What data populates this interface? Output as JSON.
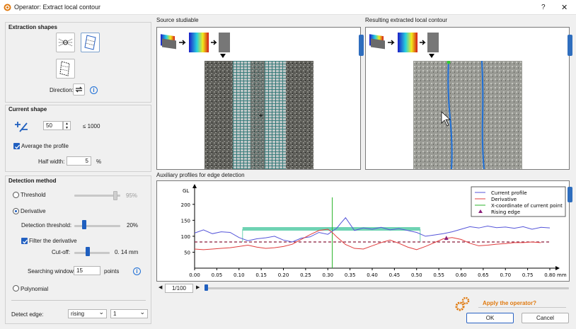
{
  "window": {
    "title": "Operator: Extract local contour",
    "help": "?",
    "close": "✕"
  },
  "extraction": {
    "heading": "Extraction shapes",
    "direction_label": "Direction:"
  },
  "current_shape": {
    "heading": "Current shape",
    "size_value": "50",
    "size_max": "≤ 1000",
    "average_label": "Average the profile",
    "half_width_label": "Half width:",
    "half_width_value": "5",
    "half_width_unit": "%"
  },
  "detection": {
    "heading": "Detection method",
    "threshold_label": "Threshold",
    "threshold_value": "95%",
    "derivative_label": "Derivative",
    "detection_threshold_label": "Detection threshold:",
    "detection_threshold_value": "20%",
    "filter_label": "Filter the derivative",
    "cutoff_label": "Cut-off:",
    "cutoff_value": "0. 14 mm",
    "searching_label": "Searching window:",
    "searching_value": "15",
    "searching_unit": "points",
    "polynomial_label": "Polynomial",
    "detect_edge_label": "Detect edge:",
    "detect_edge_value": "rising",
    "detect_edge_count": "1"
  },
  "panels": {
    "source_label": "Source studiable",
    "result_label": "Resulting extracted local contour",
    "aux_label": "Auxiliary profiles for edge detection"
  },
  "pager": {
    "value": "1/100"
  },
  "footer": {
    "apply_text": "Apply the operator?",
    "ok_label": "OK",
    "cancel_label": "Cancel"
  },
  "colors": {
    "accent": "#1f5fbf",
    "current_profile": "#5555d9",
    "derivative": "#e03c3c",
    "xcoord": "#2db52d",
    "rising": "#8b1f7a",
    "threshold_line": "#8b1b3b",
    "band": "#6fd3b3",
    "orange": "#e07a10"
  },
  "chart_data": {
    "type": "line",
    "ylabel": "GL",
    "xunit": "mm",
    "xlim": [
      0,
      0.8
    ],
    "ylim": [
      0,
      255
    ],
    "x_ticks": [
      "0.00",
      "0.05",
      "0.10",
      "0.15",
      "0.20",
      "0.25",
      "0.30",
      "0.35",
      "0.40",
      "0.45",
      "0.50",
      "0.55",
      "0.60",
      "0.65",
      "0.70",
      "0.75",
      "0.80"
    ],
    "y_ticks": [
      "50",
      "100",
      "150",
      "200"
    ],
    "legend": [
      "Current profile",
      "Derivative",
      "X-coordinate of current point",
      "Rising edge"
    ],
    "legend_placement": "top-right",
    "series": [
      {
        "name": "Current profile",
        "x": [
          0.0,
          0.02,
          0.04,
          0.06,
          0.08,
          0.1,
          0.12,
          0.14,
          0.16,
          0.18,
          0.2,
          0.22,
          0.24,
          0.26,
          0.28,
          0.3,
          0.32,
          0.33,
          0.34,
          0.36,
          0.38,
          0.4,
          0.42,
          0.44,
          0.46,
          0.48,
          0.5,
          0.52,
          0.54,
          0.56,
          0.58,
          0.6,
          0.62,
          0.64,
          0.66,
          0.68,
          0.7,
          0.72,
          0.74,
          0.76,
          0.78,
          0.8
        ],
        "y": [
          110,
          120,
          108,
          114,
          112,
          96,
          86,
          92,
          95,
          100,
          88,
          82,
          94,
          98,
          112,
          106,
          125,
          142,
          158,
          118,
          126,
          122,
          128,
          120,
          124,
          118,
          112,
          100,
          104,
          108,
          114,
          122,
          130,
          126,
          132,
          127,
          129,
          125,
          130,
          122,
          128,
          126
        ]
      },
      {
        "name": "Derivative",
        "x": [
          0.0,
          0.02,
          0.04,
          0.06,
          0.08,
          0.1,
          0.12,
          0.14,
          0.16,
          0.18,
          0.2,
          0.22,
          0.24,
          0.26,
          0.28,
          0.3,
          0.31,
          0.32,
          0.34,
          0.36,
          0.38,
          0.4,
          0.42,
          0.44,
          0.46,
          0.48,
          0.5,
          0.52,
          0.54,
          0.56,
          0.58,
          0.6,
          0.62,
          0.64,
          0.66,
          0.68,
          0.7,
          0.72,
          0.74,
          0.76,
          0.78
        ],
        "y": [
          60,
          58,
          60,
          62,
          64,
          68,
          72,
          66,
          62,
          64,
          68,
          75,
          90,
          105,
          118,
          122,
          112,
          98,
          74,
          62,
          60,
          70,
          80,
          88,
          78,
          66,
          58,
          68,
          80,
          92,
          96,
          90,
          78,
          70,
          72,
          75,
          77,
          80,
          80,
          82,
          80
        ]
      },
      {
        "name": "Threshold",
        "y_const": 82
      }
    ],
    "current_x": 0.31,
    "band": {
      "x0": 0.108,
      "x1": 0.508,
      "y": 122
    },
    "rising_edge": {
      "x": 0.567,
      "y": 95
    }
  }
}
